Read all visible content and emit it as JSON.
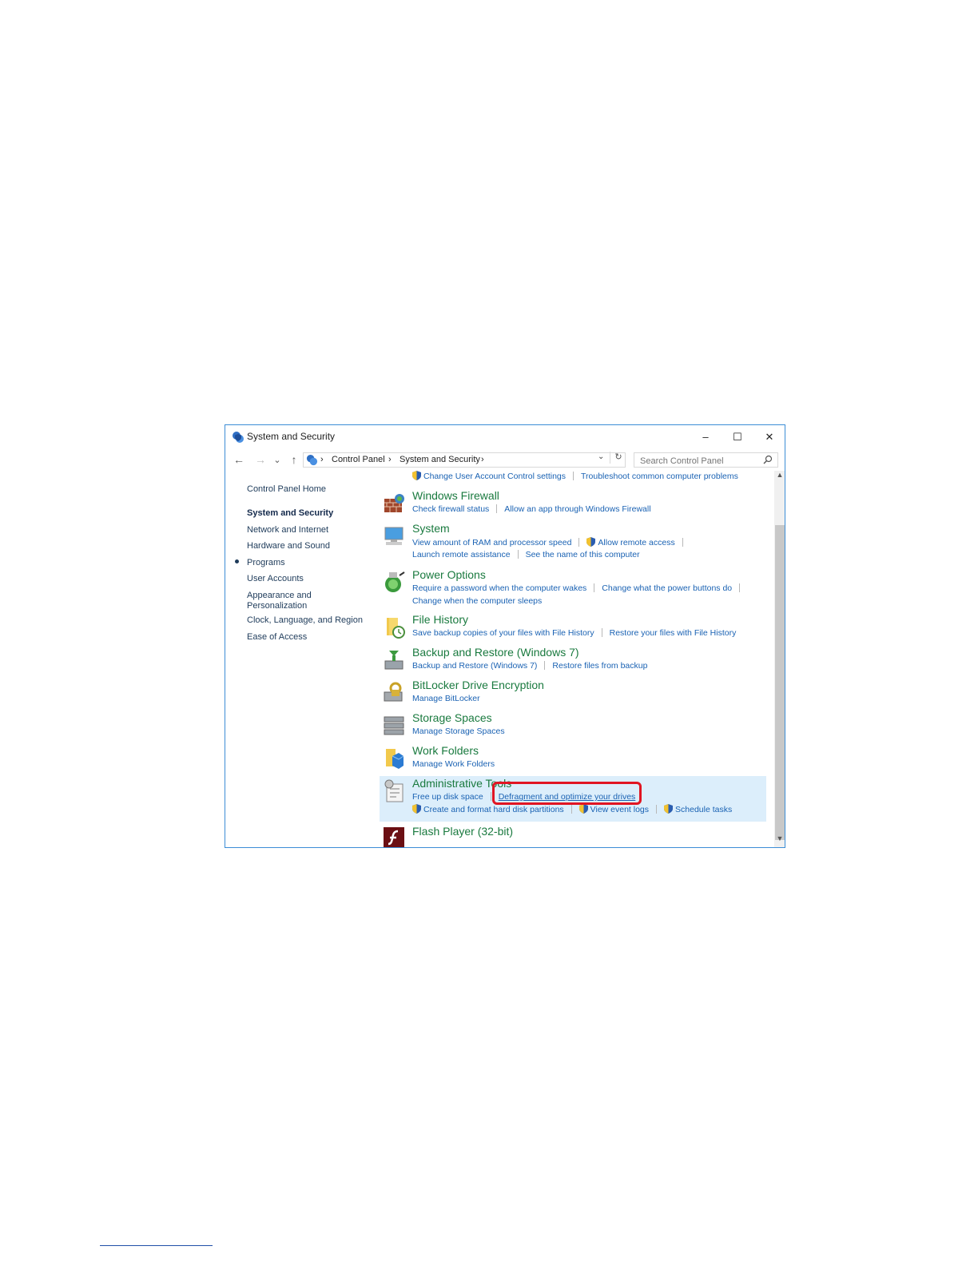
{
  "window": {
    "title": "System and Security",
    "minimize_glyph": "–",
    "maximize_glyph": "☐",
    "close_glyph": "✕"
  },
  "nav": {
    "back_glyph": "←",
    "forward_glyph": "→",
    "recent_glyph": "⌄",
    "up_glyph": "↑",
    "breadcrumb": [
      "Control Panel",
      "System and Security"
    ],
    "separator": "›",
    "refresh_glyph": "↻",
    "dropdown_glyph": "⌄"
  },
  "search": {
    "placeholder": "Search Control Panel"
  },
  "sidebar": {
    "items": [
      {
        "label": "Control Panel Home"
      },
      {
        "label": "System and Security",
        "current": true
      },
      {
        "label": "Network and Internet"
      },
      {
        "label": "Hardware and Sound"
      },
      {
        "label": "Programs"
      },
      {
        "label": "User Accounts"
      },
      {
        "label": "Appearance and"
      },
      {
        "label": "Personalization"
      },
      {
        "label": "Clock, Language, and Region"
      },
      {
        "label": "Ease of Access"
      }
    ]
  },
  "categories": {
    "top_partial": {
      "links": [
        "Change User Account Control settings",
        "Troubleshoot common computer problems"
      ]
    },
    "firewall": {
      "title": "Windows Firewall",
      "links": [
        "Check firewall status",
        "Allow an app through Windows Firewall"
      ]
    },
    "system": {
      "title": "System",
      "links": [
        "View amount of RAM and processor speed",
        "Allow remote access",
        "Launch remote assistance",
        "See the name of this computer"
      ]
    },
    "power": {
      "title": "Power Options",
      "links": [
        "Require a password when the computer wakes",
        "Change what the power buttons do",
        "Change when the computer sleeps"
      ]
    },
    "filehistory": {
      "title": "File History",
      "links": [
        "Save backup copies of your files with File History",
        "Restore your files with File History"
      ]
    },
    "backup": {
      "title": "Backup and Restore (Windows 7)",
      "links": [
        "Backup and Restore (Windows 7)",
        "Restore files from backup"
      ]
    },
    "bitlocker": {
      "title": "BitLocker Drive Encryption",
      "links": [
        "Manage BitLocker"
      ]
    },
    "storage": {
      "title": "Storage Spaces",
      "links": [
        "Manage Storage Spaces"
      ]
    },
    "workfolders": {
      "title": "Work Folders",
      "links": [
        "Manage Work Folders"
      ]
    },
    "admin": {
      "title": "Administrative Tools",
      "links": [
        "Free up disk space",
        "Defragment and optimize your drives",
        "Create and format hard disk partitions",
        "View event logs",
        "Schedule tasks"
      ]
    },
    "flash": {
      "title": "Flash Player (32-bit)"
    }
  },
  "colors": {
    "heading": "#1a7a3f",
    "link": "#1a62b3",
    "highlight_border": "#e11522",
    "selected_row": "#dceefb",
    "window_border": "#3c8dd6"
  }
}
